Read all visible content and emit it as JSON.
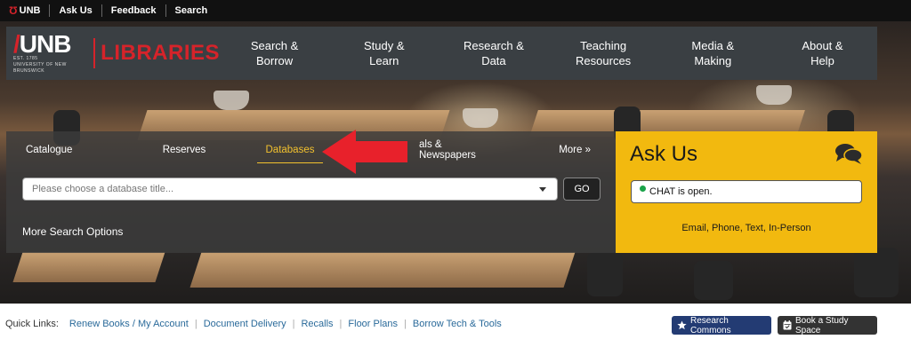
{
  "topbar": {
    "items": [
      {
        "label": "UNB",
        "icon": "unb-logo-icon"
      },
      {
        "label": "Ask Us"
      },
      {
        "label": "Feedback"
      },
      {
        "label": "Search"
      }
    ]
  },
  "logo": {
    "unb": "UNB",
    "subtitle": "UNIVERSITY OF NEW BRUNSWICK",
    "est": "EST. 1785",
    "libraries": "LIBRARIES"
  },
  "mainnav": [
    {
      "label": "Search &\nBorrow"
    },
    {
      "label": "Study &\nLearn"
    },
    {
      "label": "Research &\nData"
    },
    {
      "label": "Teaching\nResources"
    },
    {
      "label": "Media &\nMaking"
    },
    {
      "label": "About &\nHelp"
    }
  ],
  "search": {
    "tabs": [
      {
        "label": "Catalogue"
      },
      {
        "label": "Reserves"
      },
      {
        "label": "Databases",
        "active": true
      },
      {
        "label": "als & Newspapers"
      },
      {
        "label": "More »"
      }
    ],
    "select_placeholder": "Please choose a database title...",
    "go_label": "GO",
    "more_options": "More Search Options"
  },
  "askus": {
    "title": "Ask Us",
    "chat_status": "CHAT is open.",
    "methods": "Email, Phone, Text, In-Person"
  },
  "quicklinks": {
    "label": "Quick Links:",
    "links": [
      "Renew Books / My Account",
      "Document Delivery",
      "Recalls",
      "Floor Plans",
      "Borrow Tech & Tools"
    ],
    "research_commons": "Research Commons",
    "book_study_space": "Book a Study Space"
  },
  "colors": {
    "brand_red": "#d6232a",
    "ask_yellow": "#f2b90f",
    "nav_bg": "#3a3f43",
    "link_blue": "#2a6a9a",
    "research_btn": "#233b73"
  }
}
